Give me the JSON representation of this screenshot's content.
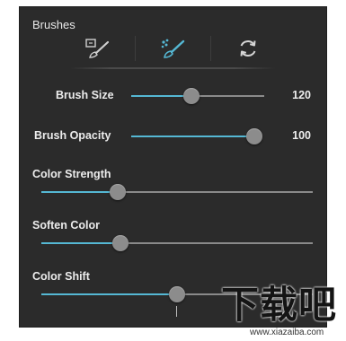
{
  "panel": {
    "title": "Brushes",
    "tools": [
      {
        "name": "paint-brush-tool",
        "icon": "brush-with-box-icon",
        "active": false
      },
      {
        "name": "soften-brush-tool",
        "icon": "brush-dots-icon",
        "active": true
      },
      {
        "name": "reset-tool",
        "icon": "refresh-icon",
        "active": false
      }
    ],
    "sliders": {
      "brush_size": {
        "label": "Brush Size",
        "value": "120",
        "level": 0.45
      },
      "brush_opacity": {
        "label": "Brush Opacity",
        "value": "100",
        "level": 1.0
      },
      "color_strength": {
        "label": "Color Strength",
        "level": 0.28
      },
      "soften_color": {
        "label": "Soften Color",
        "level": 0.29
      },
      "color_shift": {
        "label": "Color Shift",
        "level": 0.5
      }
    }
  },
  "colors": {
    "panel_bg": "#2b2b2b",
    "accent": "#55b8d4",
    "track": "#8a8a8a",
    "thumb": "#8c8c8c"
  },
  "watermark": {
    "main": "下载吧",
    "sub": "www.xiazaiba.com"
  }
}
